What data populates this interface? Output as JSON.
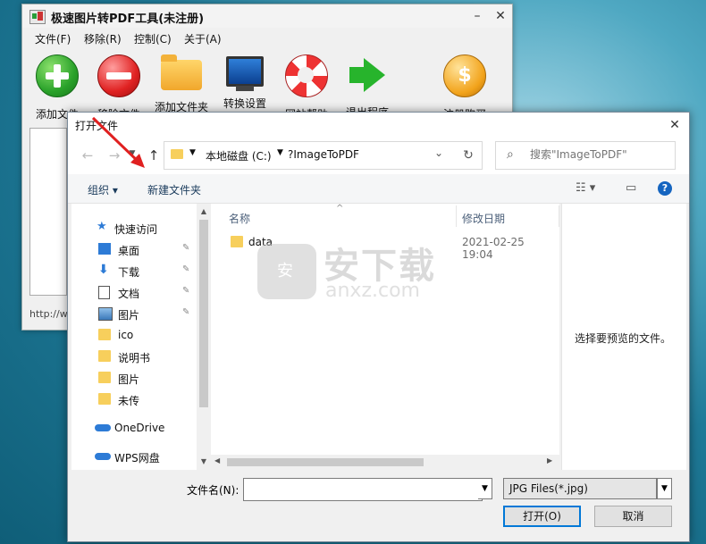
{
  "app": {
    "title": "极速图片转PDF工具(未注册)",
    "window_controls": {
      "minimize": "–",
      "close": "✕"
    },
    "menus": [
      "文件(F)",
      "移除(R)",
      "控制(C)",
      "关于(A)"
    ],
    "toolbar": [
      {
        "label": "添加文件",
        "icon": "add-icon"
      },
      {
        "label": "移除文件",
        "icon": "remove-icon"
      },
      {
        "label": "添加文件夹",
        "icon": "folder-icon"
      },
      {
        "label": "转换设置",
        "icon": "monitor-icon"
      },
      {
        "label": "网站帮助",
        "icon": "lifebuoy-icon"
      },
      {
        "label": "退出程序",
        "icon": "exit-arrow-icon"
      },
      {
        "label": "注册购买",
        "icon": "dollar-icon",
        "glyph": "$"
      }
    ],
    "status_text": "http://w"
  },
  "dialog": {
    "title": "打开文件",
    "close_glyph": "✕",
    "nav_glyphs": {
      "back": "←",
      "forward": "→",
      "up": "↑",
      "refresh": "↻"
    },
    "address": {
      "segment1": "本地磁盘 (C:)",
      "segment2": "?ImageToPDF"
    },
    "search_placeholder": "搜索\"ImageToPDF\"",
    "commands": {
      "organize": "组织 ▾",
      "new_folder": "新建文件夹",
      "view": "☷ ▾",
      "pane": "▭",
      "help": "?"
    },
    "nav_pane": {
      "quick_access": "快速访问",
      "items": [
        {
          "label": "桌面",
          "icon": "desktop-icon",
          "pinned": true
        },
        {
          "label": "下载",
          "icon": "download-icon",
          "pinned": true
        },
        {
          "label": "文档",
          "icon": "document-icon",
          "pinned": true
        },
        {
          "label": "图片",
          "icon": "pictures-icon",
          "pinned": true
        },
        {
          "label": "ico",
          "icon": "folder-icon",
          "pinned": false
        },
        {
          "label": "说明书",
          "icon": "folder-icon",
          "pinned": false
        },
        {
          "label": "图片",
          "icon": "folder-icon",
          "pinned": false
        },
        {
          "label": "未传",
          "icon": "folder-icon",
          "pinned": false
        }
      ],
      "onedrive": "OneDrive",
      "wps": "WPS网盘",
      "pin_glyph": "✎"
    },
    "columns": {
      "name": "名称",
      "modified": "修改日期",
      "sort_glyph": "^"
    },
    "files": [
      {
        "name": "data",
        "modified": "2021-02-25 19:04"
      }
    ],
    "preview_text": "选择要预览的文件。",
    "filename_label": "文件名(N):",
    "filename_value": "",
    "filetype": "JPG Files(*.jpg)",
    "dropdown_glyph": "▼",
    "open_button": "打开(O)",
    "cancel_button": "取消"
  },
  "watermark": {
    "badge": "安",
    "text": "安下载",
    "domain": "anxz.com"
  },
  "colors": {
    "accent": "#0078d7",
    "annotation": "#e02020",
    "folder": "#f7cf5c"
  }
}
